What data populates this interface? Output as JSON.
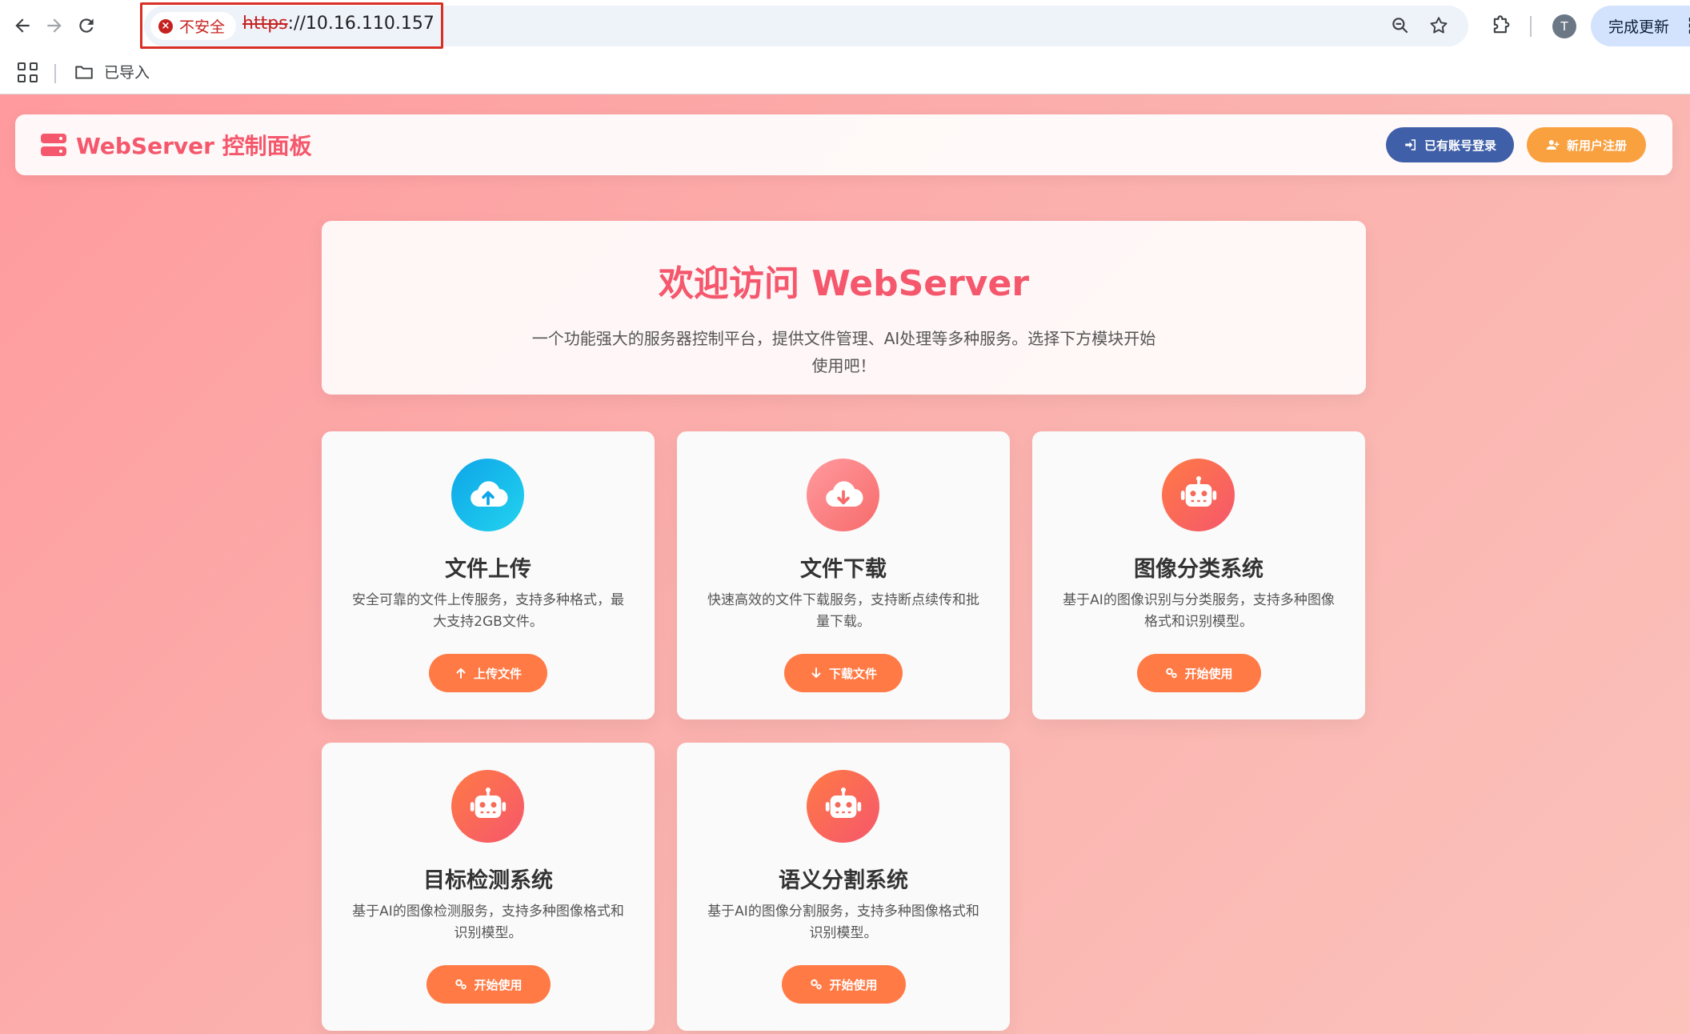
{
  "browser": {
    "security_label": "不安全",
    "url_scheme": "https",
    "url_rest": "://10.16.110.157",
    "avatar_letter": "T",
    "update_label": "完成更新",
    "bookmark_folder": "已导入"
  },
  "header": {
    "title": "WebServer 控制面板",
    "login_label": "已有账号登录",
    "register_label": "新用户注册"
  },
  "welcome": {
    "title": "欢迎访问 WebServer",
    "description": "一个功能强大的服务器控制平台，提供文件管理、AI处理等多种服务。选择下方模块开始使用吧！"
  },
  "cards": [
    {
      "title": "文件上传",
      "description": "安全可靠的文件上传服务，支持多种格式，最大支持2GB文件。",
      "button": "上传文件",
      "icon": "cloud-upload-icon"
    },
    {
      "title": "文件下载",
      "description": "快速高效的文件下载服务，支持断点续传和批量下载。",
      "button": "下载文件",
      "icon": "cloud-download-icon"
    },
    {
      "title": "图像分类系统",
      "description": "基于AI的图像识别与分类服务，支持多种图像格式和识别模型。",
      "button": "开始使用",
      "icon": "robot-icon"
    },
    {
      "title": "目标检测系统",
      "description": "基于AI的图像检测服务，支持多种图像格式和识别模型。",
      "button": "开始使用",
      "icon": "robot-icon"
    },
    {
      "title": "语义分割系统",
      "description": "基于AI的图像分割服务，支持多种图像格式和识别模型。",
      "button": "开始使用",
      "icon": "robot-icon"
    }
  ],
  "colors": {
    "accent": "#f5576c",
    "button": "#ff7a45",
    "login": "#3f5fa8",
    "register": "#f9a03f"
  }
}
